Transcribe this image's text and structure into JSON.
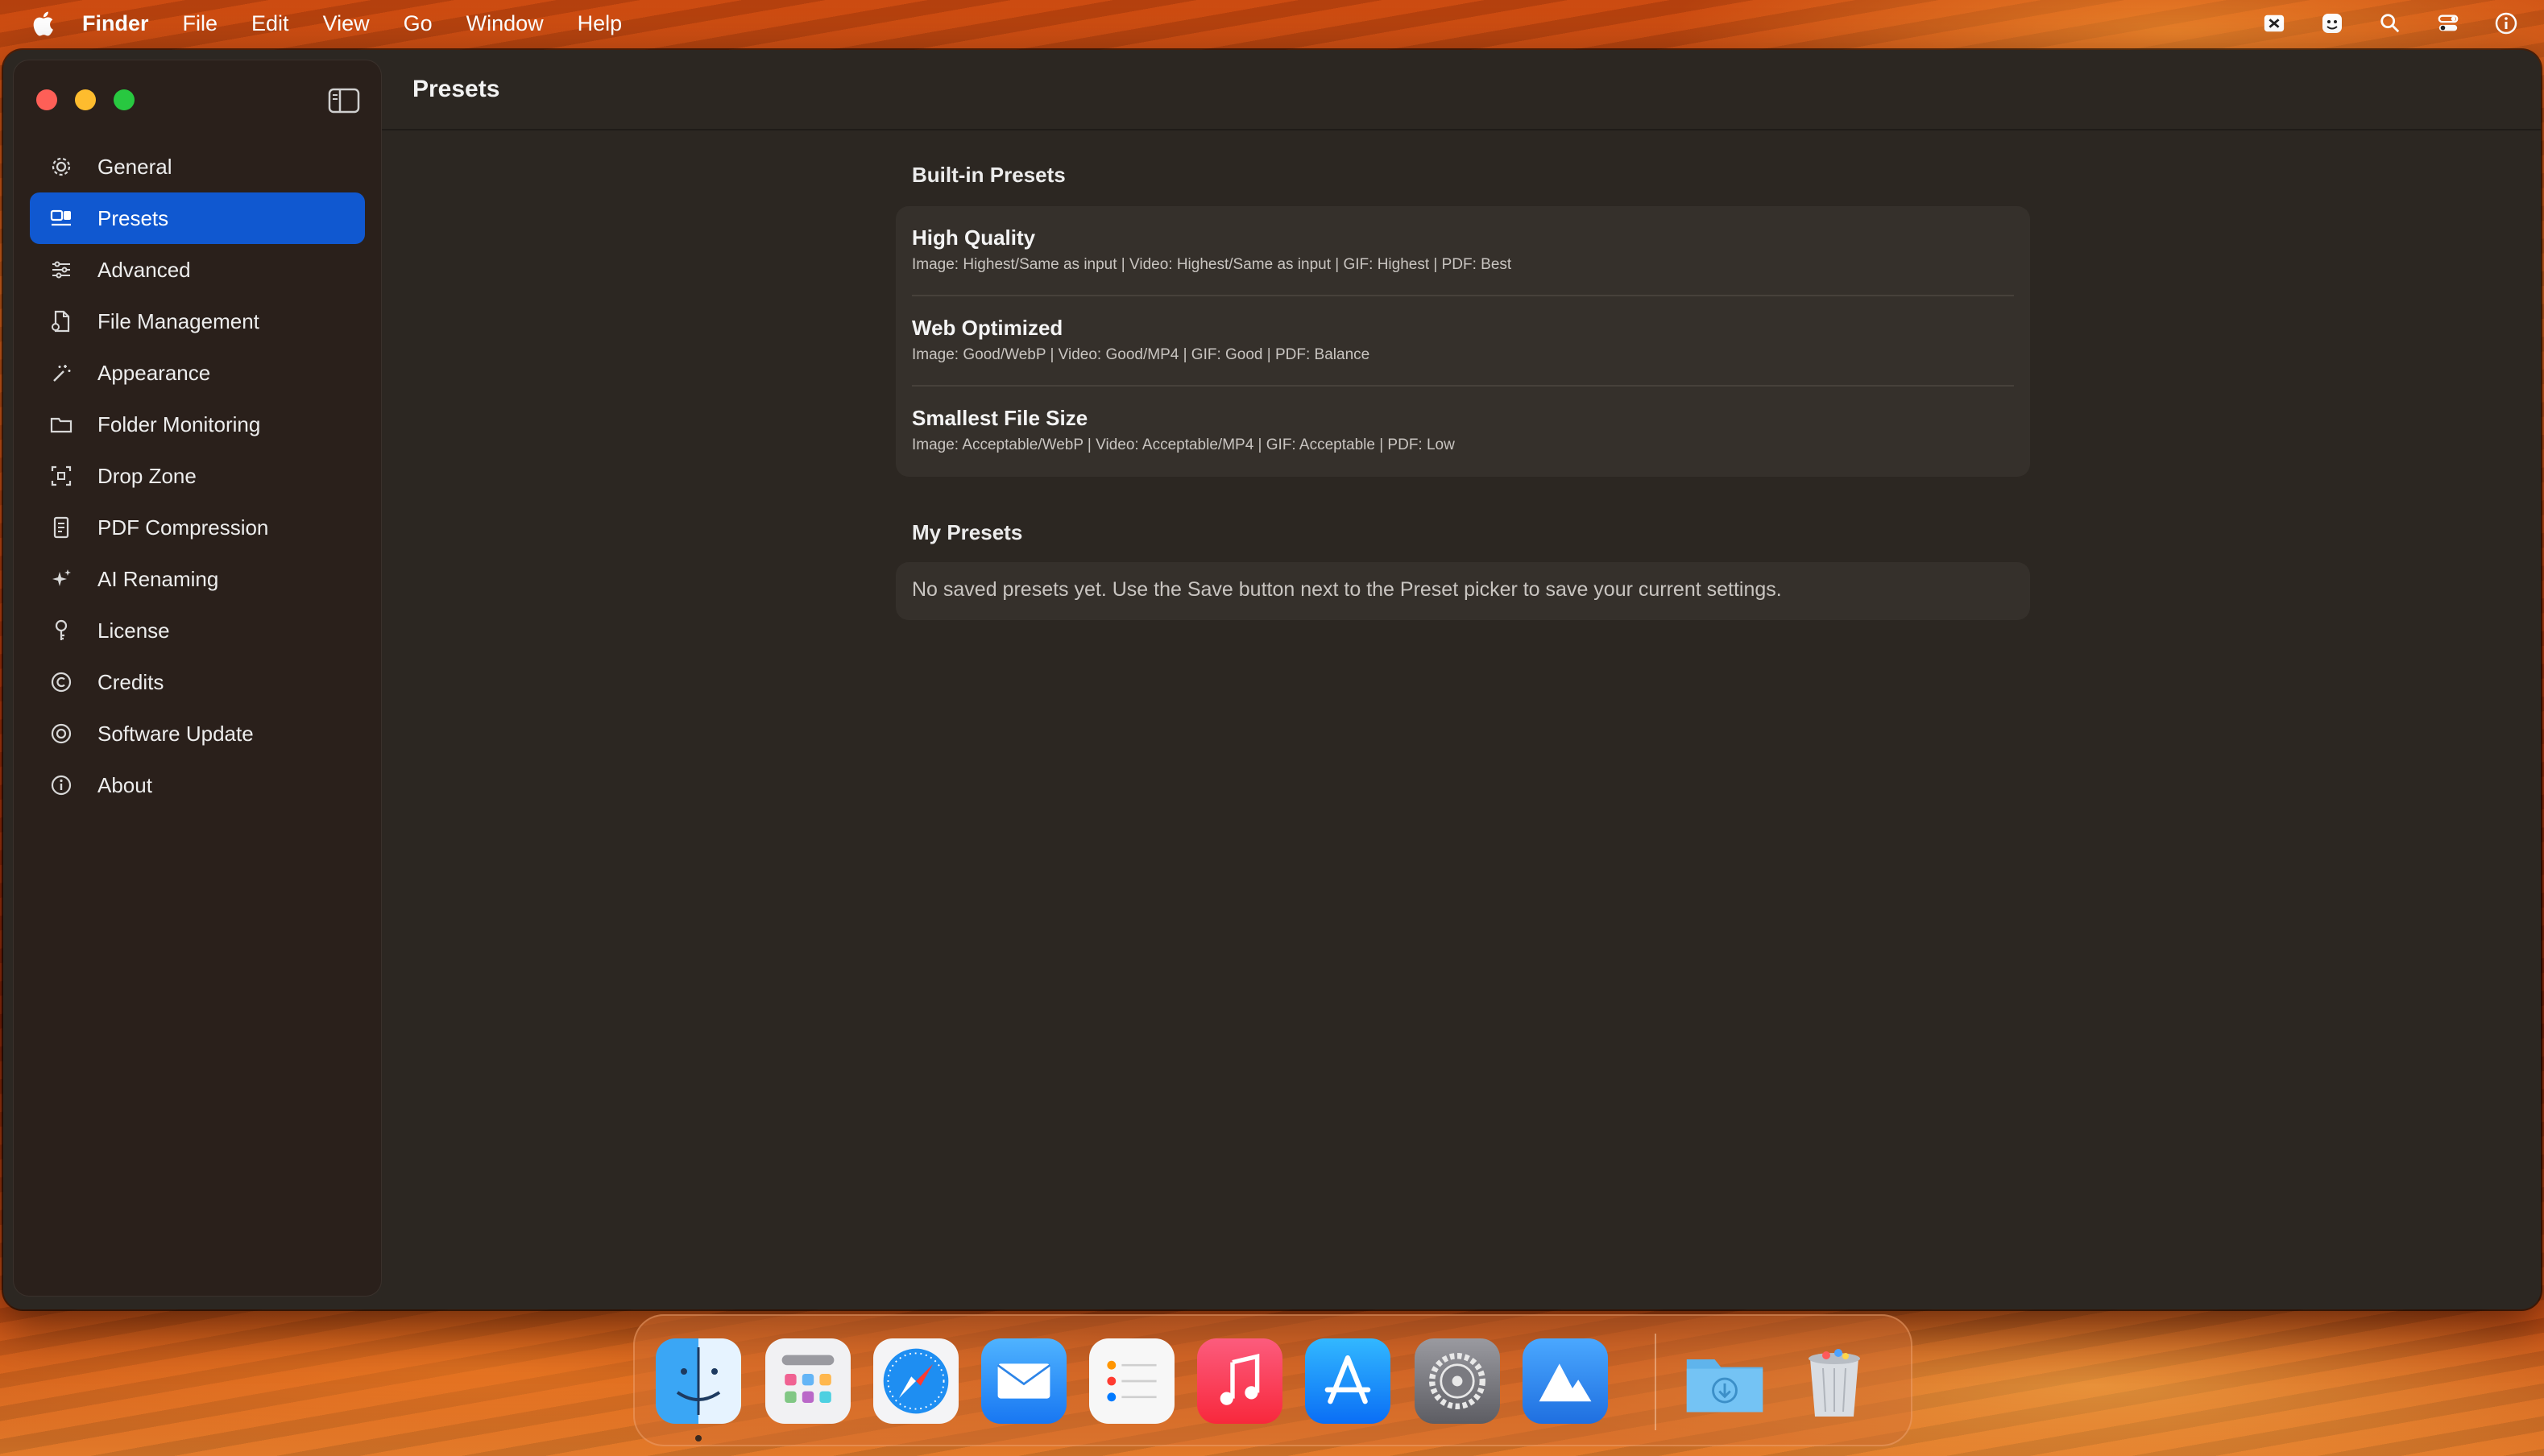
{
  "menubar": {
    "apple_icon": "apple-logo-icon",
    "items": [
      "Finder",
      "File",
      "Edit",
      "View",
      "Go",
      "Window",
      "Help"
    ],
    "status_icons": [
      "close-box-icon",
      "face-icon",
      "search-icon",
      "control-center-icon",
      "info-icon"
    ]
  },
  "window": {
    "title": "Presets",
    "traffic_lights": {
      "close": "#fe5f57",
      "minimize": "#febc2e",
      "maximize": "#28c840"
    }
  },
  "sidebar": {
    "items": [
      {
        "label": "General",
        "icon": "gear-icon"
      },
      {
        "label": "Presets",
        "icon": "presets-icon",
        "selected": true
      },
      {
        "label": "Advanced",
        "icon": "sliders-icon"
      },
      {
        "label": "File Management",
        "icon": "document-icon"
      },
      {
        "label": "Appearance",
        "icon": "wand-icon"
      },
      {
        "label": "Folder Monitoring",
        "icon": "folder-icon"
      },
      {
        "label": "Drop Zone",
        "icon": "drop-zone-icon"
      },
      {
        "label": "PDF Compression",
        "icon": "pdf-icon"
      },
      {
        "label": "AI Renaming",
        "icon": "sparkles-icon"
      },
      {
        "label": "License",
        "icon": "key-icon"
      },
      {
        "label": "Credits",
        "icon": "copyright-icon"
      },
      {
        "label": "Software Update",
        "icon": "update-icon"
      },
      {
        "label": "About",
        "icon": "info-circle-icon"
      }
    ],
    "accent": "#1058d0"
  },
  "main": {
    "builtin_heading": "Built-in Presets",
    "presets": [
      {
        "name": "High Quality",
        "desc": "Image: Highest/Same as input | Video: Highest/Same as input | GIF: Highest | PDF: Best"
      },
      {
        "name": "Web Optimized",
        "desc": "Image: Good/WebP | Video: Good/MP4 | GIF: Good | PDF: Balance"
      },
      {
        "name": "Smallest File Size",
        "desc": "Image: Acceptable/WebP | Video: Acceptable/MP4 | GIF: Acceptable | PDF: Low"
      }
    ],
    "my_heading": "My Presets",
    "empty_message": "No saved presets yet. Use the Save button next to the Preset picker to save your current settings."
  },
  "dock": {
    "apps": [
      "finder-icon",
      "launchpad-icon",
      "safari-icon",
      "mail-icon",
      "reminders-icon",
      "music-icon",
      "app-store-icon",
      "system-settings-icon",
      "affinity-icon",
      "downloads-folder-icon",
      "trash-icon"
    ]
  }
}
